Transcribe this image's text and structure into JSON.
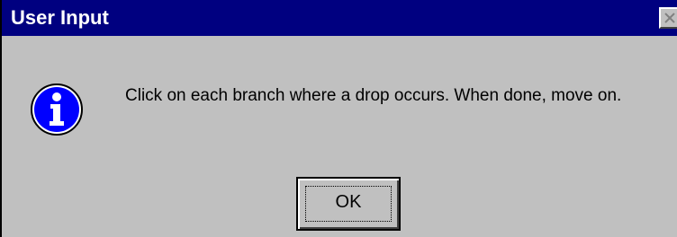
{
  "window": {
    "title": "User Input",
    "close_icon": "close-icon"
  },
  "content": {
    "icon": "information-icon",
    "message": "Click on each branch where a drop occurs. When done, move on."
  },
  "buttons": {
    "ok_label": "OK"
  },
  "colors": {
    "titlebar": "#000080",
    "title_text": "#ffffff",
    "dialog_face": "#c0c0c0",
    "icon_fill": "#0000ff"
  }
}
